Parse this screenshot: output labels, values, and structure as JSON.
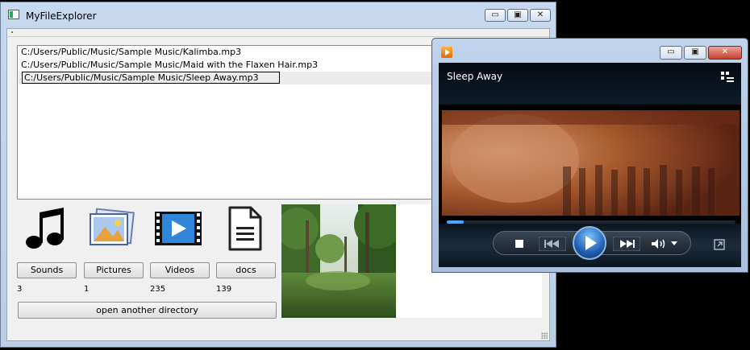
{
  "explorer": {
    "title": "MyFileExplorer",
    "window_buttons": {
      "minimize": "▭",
      "maximize": "▣",
      "close": "✕"
    },
    "files": [
      "C:/Users/Public/Music/Sample Music/Kalimba.mp3",
      "C:/Users/Public/Music/Sample Music/Maid with the Flaxen Hair.mp3",
      "C:/Users/Public/Music/Sample Music/Sleep Away.mp3"
    ],
    "selected_index": 2,
    "categories": [
      {
        "icon": "music-note-icon",
        "label": "Sounds",
        "count": "3"
      },
      {
        "icon": "pictures-icon",
        "label": "Pictures",
        "count": "1"
      },
      {
        "icon": "videos-icon",
        "label": "Videos",
        "count": "235"
      },
      {
        "icon": "document-icon",
        "label": "docs",
        "count": "139"
      }
    ],
    "open_button": "open another directory",
    "preview_image": "forest-thumbnail"
  },
  "media_player": {
    "now_playing": "Sleep Away",
    "progress_fraction": 0.06,
    "controls": [
      "stop-icon",
      "previous-icon",
      "play-icon",
      "next-icon",
      "volume-icon",
      "volume-dropdown-icon",
      "switch-to-library-icon"
    ],
    "accent": "#1f5fb3"
  }
}
